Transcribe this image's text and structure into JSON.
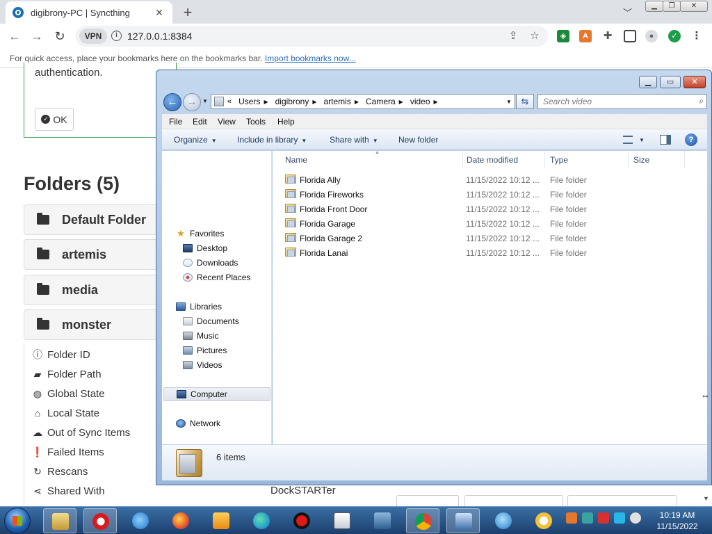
{
  "browser": {
    "tab_title": "digibrony-PC | Syncthing",
    "new_tab": "+",
    "tab_close": "✕",
    "url": "127.0.0.1:8384",
    "vpn": "VPN",
    "bookmarks_text": "For quick access, place your bookmarks here on the bookmarks bar.",
    "bookmarks_link": "Import bookmarks now..."
  },
  "syncthing": {
    "auth_text": "authentication.",
    "ok_label": "OK",
    "folders_title": "Folders (5)",
    "folders": [
      "Default Folder",
      "artemis",
      "media",
      "monster"
    ],
    "details": [
      {
        "icon": "ⓘ",
        "label": "Folder ID"
      },
      {
        "icon": "▰",
        "label": "Folder Path"
      },
      {
        "icon": "◍",
        "label": "Global State"
      },
      {
        "icon": "⌂",
        "label": "Local State"
      },
      {
        "icon": "☁",
        "label": "Out of Sync Items"
      },
      {
        "icon": "❗",
        "label": "Failed Items"
      },
      {
        "icon": "↻",
        "label": "Rescans"
      },
      {
        "icon": "⋖",
        "label": "Shared With"
      }
    ],
    "dockstarter": "DockSTARTer"
  },
  "explorer": {
    "path": [
      "Users",
      "digibrony",
      "artemis",
      "Camera",
      "video"
    ],
    "search_placeholder": "Search video",
    "menus": [
      "File",
      "Edit",
      "View",
      "Tools",
      "Help"
    ],
    "commands": {
      "organize": "Organize",
      "include": "Include in library",
      "share": "Share with",
      "new_folder": "New folder"
    },
    "nav": {
      "favorites": "Favorites",
      "desktop": "Desktop",
      "downloads": "Downloads",
      "recent": "Recent Places",
      "libraries": "Libraries",
      "documents": "Documents",
      "music": "Music",
      "pictures": "Pictures",
      "videos": "Videos",
      "computer": "Computer",
      "network": "Network"
    },
    "columns": {
      "name": "Name",
      "date": "Date modified",
      "type": "Type",
      "size": "Size"
    },
    "files": [
      {
        "name": "Florida Ally",
        "date": "11/15/2022 10:12 ...",
        "type": "File folder"
      },
      {
        "name": "Florida Fireworks",
        "date": "11/15/2022 10:12 ...",
        "type": "File folder"
      },
      {
        "name": "Florida Front Door",
        "date": "11/15/2022 10:12 ...",
        "type": "File folder"
      },
      {
        "name": "Florida Garage",
        "date": "11/15/2022 10:12 ...",
        "type": "File folder"
      },
      {
        "name": "Florida Garage 2",
        "date": "11/15/2022 10:12 ...",
        "type": "File folder"
      },
      {
        "name": "Florida Lanai",
        "date": "11/15/2022 10:12 ...",
        "type": "File folder"
      }
    ],
    "items_count": "6 items"
  },
  "taskbar": {
    "time": "10:19 AM",
    "date": "11/15/2022"
  }
}
